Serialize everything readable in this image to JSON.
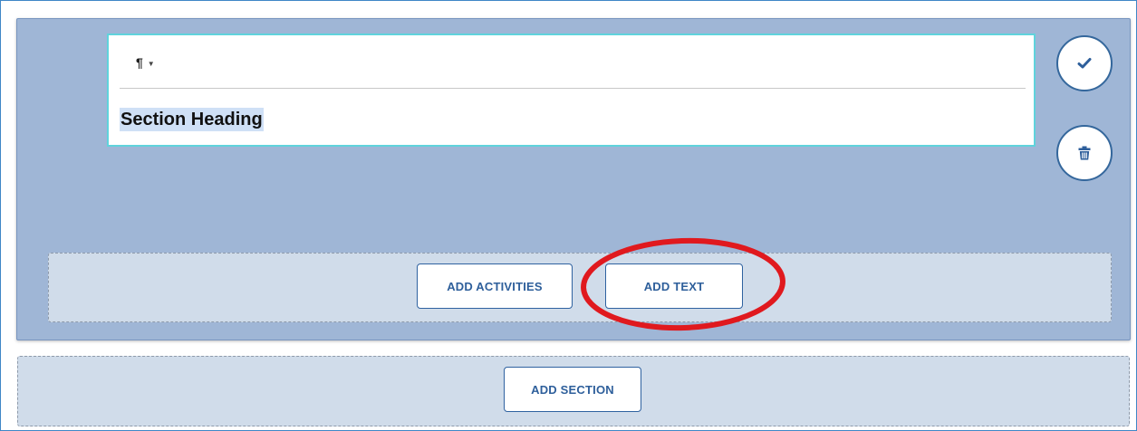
{
  "editor": {
    "format_dropdown_label": "¶",
    "heading_text": "Section Heading"
  },
  "buttons": {
    "add_activities": "ADD ACTIVITIES",
    "add_text": "ADD TEXT",
    "add_section": "ADD SECTION"
  },
  "icons": {
    "confirm": "check-icon",
    "delete": "trash-icon",
    "highlight": "red-ellipse-annotation"
  },
  "colors": {
    "section_background": "#9fb6d6",
    "drop_zone_background": "#d0dcea",
    "button_text": "#2e5f9b",
    "button_border": "#2f62a0",
    "editor_border": "#5fd3dc",
    "text_selection": "#cfe0f6",
    "annotation": "#e0191e"
  }
}
